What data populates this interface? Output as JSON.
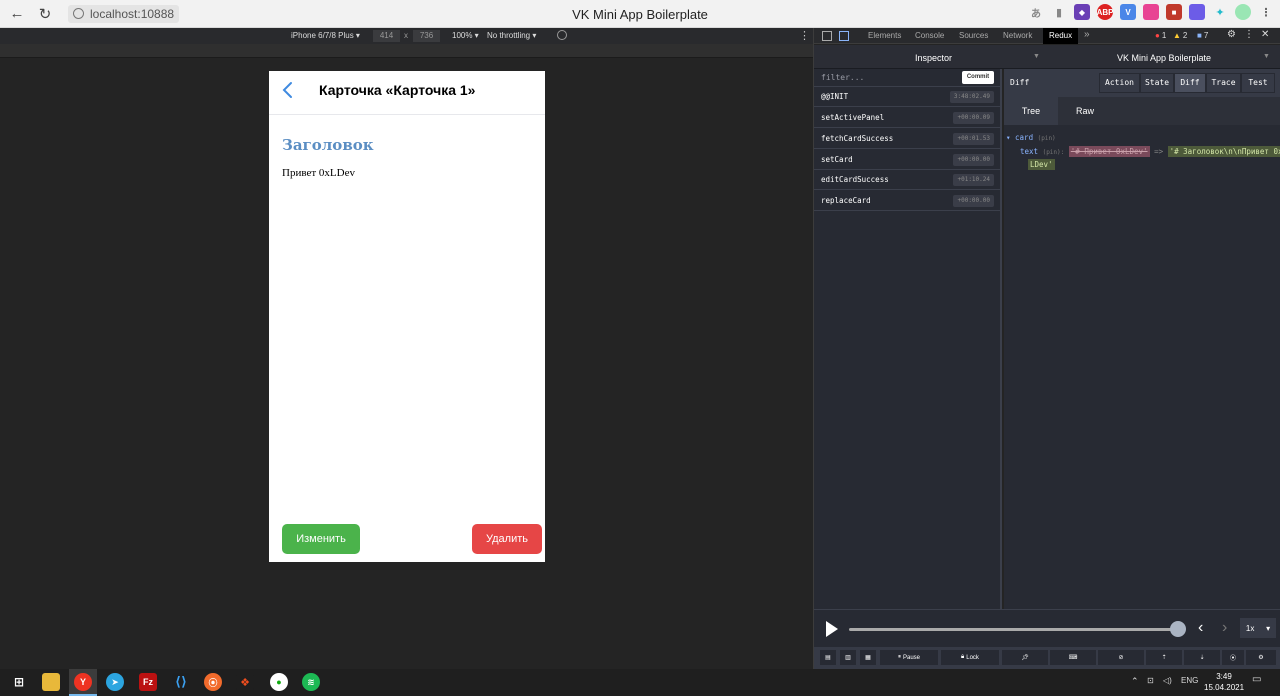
{
  "browser": {
    "url": "localhost:10888",
    "title": "VK Mini App Boilerplate"
  },
  "device_toolbar": {
    "device": "iPhone 6/7/8 Plus ▾",
    "width": "414",
    "height": "736",
    "x": "x",
    "zoom": "100% ▾",
    "throttling": "No throttling ▾",
    "more": "⋮"
  },
  "phone": {
    "title": "Карточка «Карточка 1»",
    "heading": "Заголовок",
    "text": "Привет 0xLDev",
    "edit_label": "Изменить",
    "delete_label": "Удалить"
  },
  "devtools": {
    "tabs": [
      "Elements",
      "Console",
      "Sources",
      "Network",
      "Redux"
    ],
    "overflow": "»",
    "errors": "1",
    "warnings": "2",
    "messages": "7",
    "inspector_label": "Inspector",
    "app_name": "VK Mini App Boilerplate",
    "filter_placeholder": "filter...",
    "commit_label": "Commit",
    "actions": [
      {
        "name": "@@INIT",
        "time": "3:48:02.49"
      },
      {
        "name": "setActivePanel",
        "time": "+00:00.09"
      },
      {
        "name": "fetchCardSuccess",
        "time": "+00:01.53"
      },
      {
        "name": "setCard",
        "time": "+00:00.00"
      },
      {
        "name": "editCardSuccess",
        "time": "+01:10.24"
      },
      {
        "name": "replaceCard",
        "time": "+00:00.00"
      }
    ],
    "diff_label": "Diff",
    "monitor_tabs": [
      "Action",
      "State",
      "Diff",
      "Trace",
      "Test"
    ],
    "sub_tabs": [
      "Tree",
      "Raw"
    ],
    "tree": {
      "root_key": "card",
      "root_type": "(pin)",
      "child_key": "text",
      "child_type": "(pin):",
      "old_value": "'# Привет 0xLDev'",
      "arrow": "=>",
      "new_value": "'# Заголовок\\n\\nПривет 0x",
      "new_value_cont": "LDev'"
    },
    "speed": "1x",
    "footer": {
      "pause": "Pause",
      "lock": "Lock"
    }
  },
  "taskbar": {
    "lang": "ENG",
    "time": "3:49",
    "date": "15.04.2021"
  },
  "colors": {
    "accent": "#5b8ec3",
    "edit_btn": "#4bb34b",
    "delete_btn": "#e64646",
    "redux_bg": "#272a33"
  }
}
